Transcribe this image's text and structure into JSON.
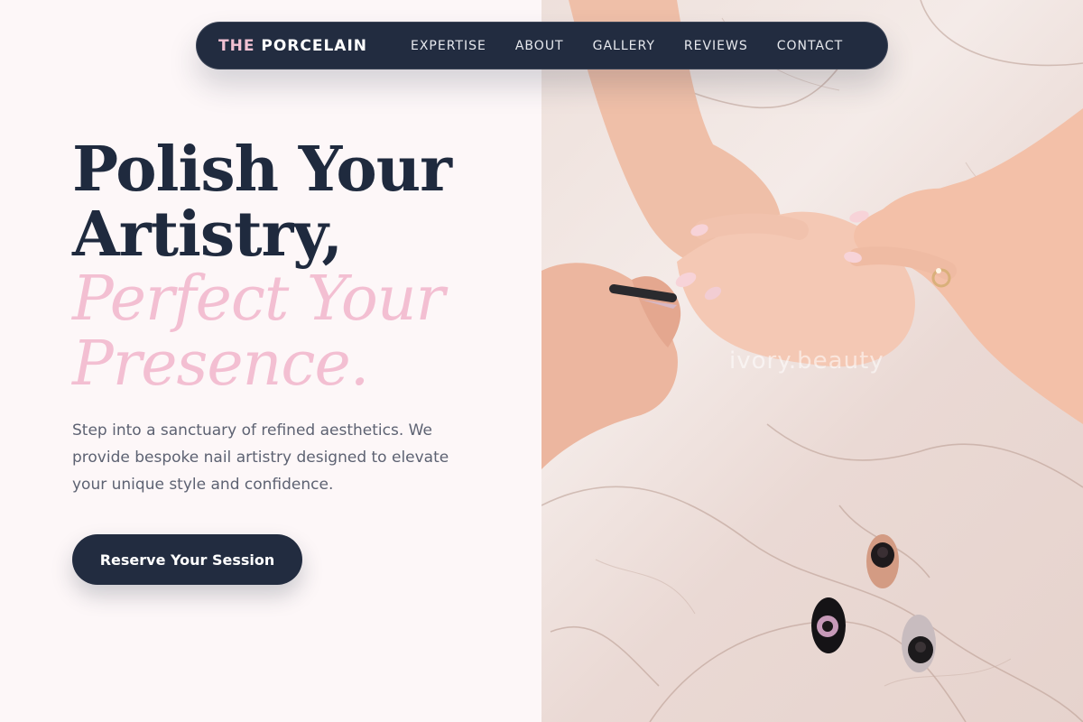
{
  "nav": {
    "brand_prefix": "THE",
    "brand_name": "PORCELAIN",
    "links": [
      "EXPERTISE",
      "ABOUT",
      "GALLERY",
      "REVIEWS",
      "CONTACT"
    ]
  },
  "hero": {
    "headline_line1": "Polish Your",
    "headline_line2": "Artistry,",
    "headline_accent1": "Perfect Your",
    "headline_accent2": "Presence.",
    "description": "Step into a sanctuary of refined aesthetics. We provide bespoke nail artistry designed to elevate your unique style and confidence.",
    "cta_label": "Reserve Your Session"
  },
  "image": {
    "watermark": "ivory.beauty",
    "subject": "manicure-hands-on-marble-with-polish-bottles"
  },
  "colors": {
    "navy": "#222c40",
    "pink_accent": "#f3bfd2",
    "background": "#fdf7f8",
    "body_text": "#5d6272"
  }
}
